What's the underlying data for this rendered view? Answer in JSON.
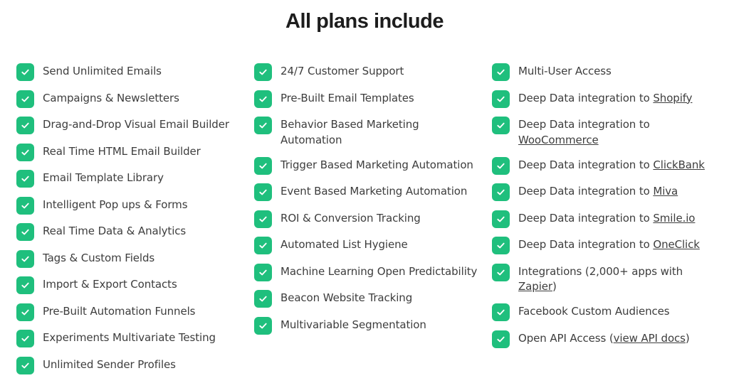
{
  "title": "All plans include",
  "accent_color": "#1fbf7d",
  "columns": [
    {
      "items": [
        {
          "text": "Send Unlimited Emails"
        },
        {
          "text": "Campaigns & Newsletters"
        },
        {
          "text": "Drag-and-Drop Visual Email Builder"
        },
        {
          "text": "Real Time HTML Email Builder"
        },
        {
          "text": "Email Template Library"
        },
        {
          "text": "Intelligent Pop ups & Forms"
        },
        {
          "text": "Real Time Data & Analytics"
        },
        {
          "text": "Tags & Custom Fields"
        },
        {
          "text": "Import & Export Contacts"
        },
        {
          "text": "Pre-Built Automation Funnels"
        },
        {
          "text": "Experiments Multivariate Testing"
        },
        {
          "text": "Unlimited Sender Profiles"
        }
      ]
    },
    {
      "items": [
        {
          "text": "24/7 Customer Support"
        },
        {
          "text": "Pre-Built Email Templates"
        },
        {
          "text": "Behavior Based Marketing Automation"
        },
        {
          "text": "Trigger Based Marketing Automation"
        },
        {
          "text": "Event Based Marketing Automation"
        },
        {
          "text": "ROI & Conversion Tracking"
        },
        {
          "text": "Automated List Hygiene"
        },
        {
          "text": "Machine Learning Open Predictability"
        },
        {
          "text": "Beacon Website Tracking"
        },
        {
          "text": "Multivariable Segmentation"
        }
      ]
    },
    {
      "items": [
        {
          "text": "Multi-User Access"
        },
        {
          "text": "Deep Data integration to ",
          "link": "Shopify"
        },
        {
          "text": "Deep Data integration to ",
          "link": "WooCommerce"
        },
        {
          "text": "Deep Data integration to ",
          "link": "ClickBank"
        },
        {
          "text": "Deep Data integration to ",
          "link": "Miva"
        },
        {
          "text": "Deep Data integration to ",
          "link": "Smile.io"
        },
        {
          "text": "Deep Data integration to ",
          "link": "OneClick"
        },
        {
          "text": "Integrations (2,000+ apps with ",
          "link": "Zapier",
          "suffix": ")"
        },
        {
          "text": "Facebook Custom Audiences"
        },
        {
          "text": "Open API Access (",
          "link": "view API docs",
          "suffix": ")"
        }
      ]
    }
  ]
}
